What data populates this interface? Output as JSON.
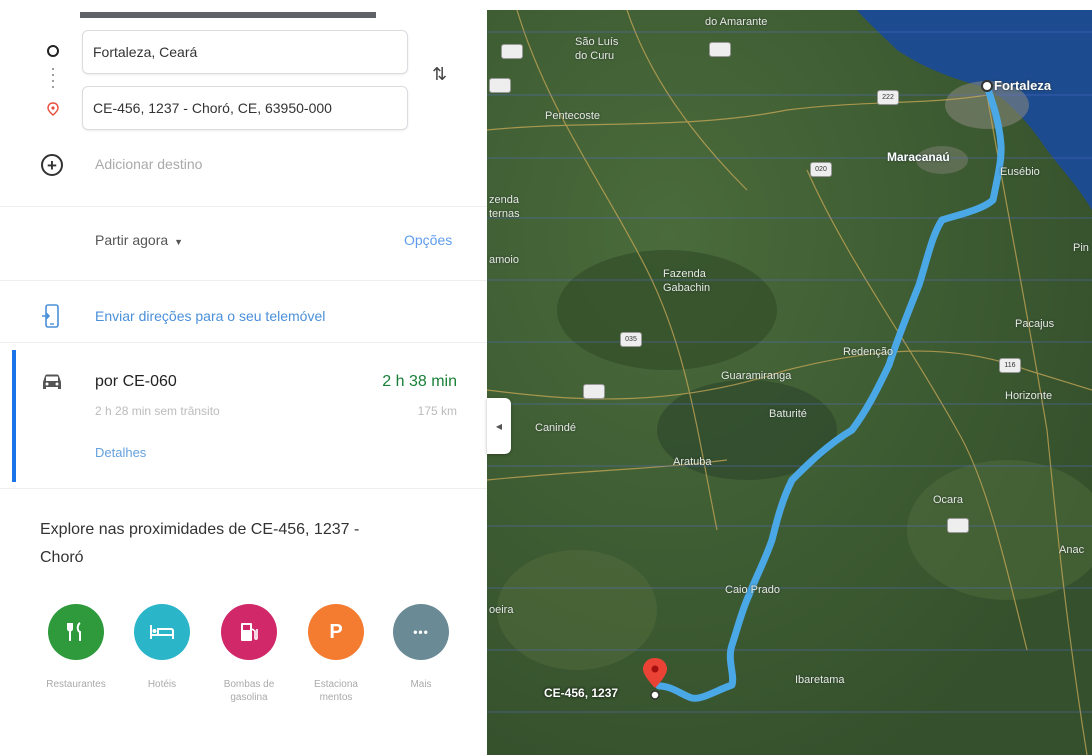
{
  "directions": {
    "origin": "Fortaleza, Ceará",
    "destination": "CE-456, 1237 - Choró, CE, 63950-000",
    "add_destination": "Adicionar destino",
    "depart": "Partir agora",
    "options": "Opções",
    "send_to_phone": "Enviar direções para o seu telemóvel"
  },
  "route": {
    "via": "por CE-060",
    "duration": "2 h 38 min",
    "note": "2 h 28 min sem trânsito",
    "distance": "175 km",
    "details": "Detalhes"
  },
  "explore": {
    "title_line1": "Explore nas proximidades de CE-456, 1237 -",
    "title_line2": "Choró",
    "items": [
      {
        "label_line1": "Restaurantes",
        "label_line2": "",
        "icon": "restaurant-icon",
        "color": "#2e9a3b",
        "glyph": "🍴"
      },
      {
        "label_line1": "Hotéis",
        "label_line2": "",
        "icon": "hotel-icon",
        "color": "#2ab5c9",
        "glyph": "🛏"
      },
      {
        "label_line1": "Bombas de",
        "label_line2": "gasolina",
        "icon": "gas-station-icon",
        "color": "#d1286a",
        "glyph": "⛽"
      },
      {
        "label_line1": "Estaciona",
        "label_line2": "mentos",
        "icon": "parking-icon",
        "color": "#f47c30",
        "glyph": "P"
      },
      {
        "label_line1": "Mais",
        "label_line2": "",
        "icon": "more-icon",
        "color": "#6a8a96",
        "glyph": "•••"
      }
    ]
  },
  "map": {
    "labels": {
      "amarante": "do Amarante",
      "sao_luis": "São Luís",
      "curu": "do Curu",
      "pentecoste": "Pentecoste",
      "fortaleza": "Fortaleza",
      "maracanau": "Maracanaú",
      "eusebio": "Eusébio",
      "fazenda": "Fazenda",
      "fazenda2": "Gabachin",
      "redencao": "Redenção",
      "guaramiranga": "Guaramiranga",
      "baturite": "Baturité",
      "pacajus": "Pacajus",
      "horizonte": "Horizonte",
      "canide": "Canindé",
      "aratuba": "Aratuba",
      "ocara": "Ocara",
      "caio_prado": "Caio Prado",
      "ibaretama": "Ibaretama",
      "zenda": "zenda",
      "temas": "ternas",
      "amoio": "amoio",
      "pin": "Pin",
      "anac": "Anac",
      "oeira": "oeira"
    },
    "destination_label": "CE-456, 1237",
    "shields": [
      "222",
      "222",
      "020",
      "035",
      "116"
    ],
    "route_color": "#4aa8e6"
  }
}
